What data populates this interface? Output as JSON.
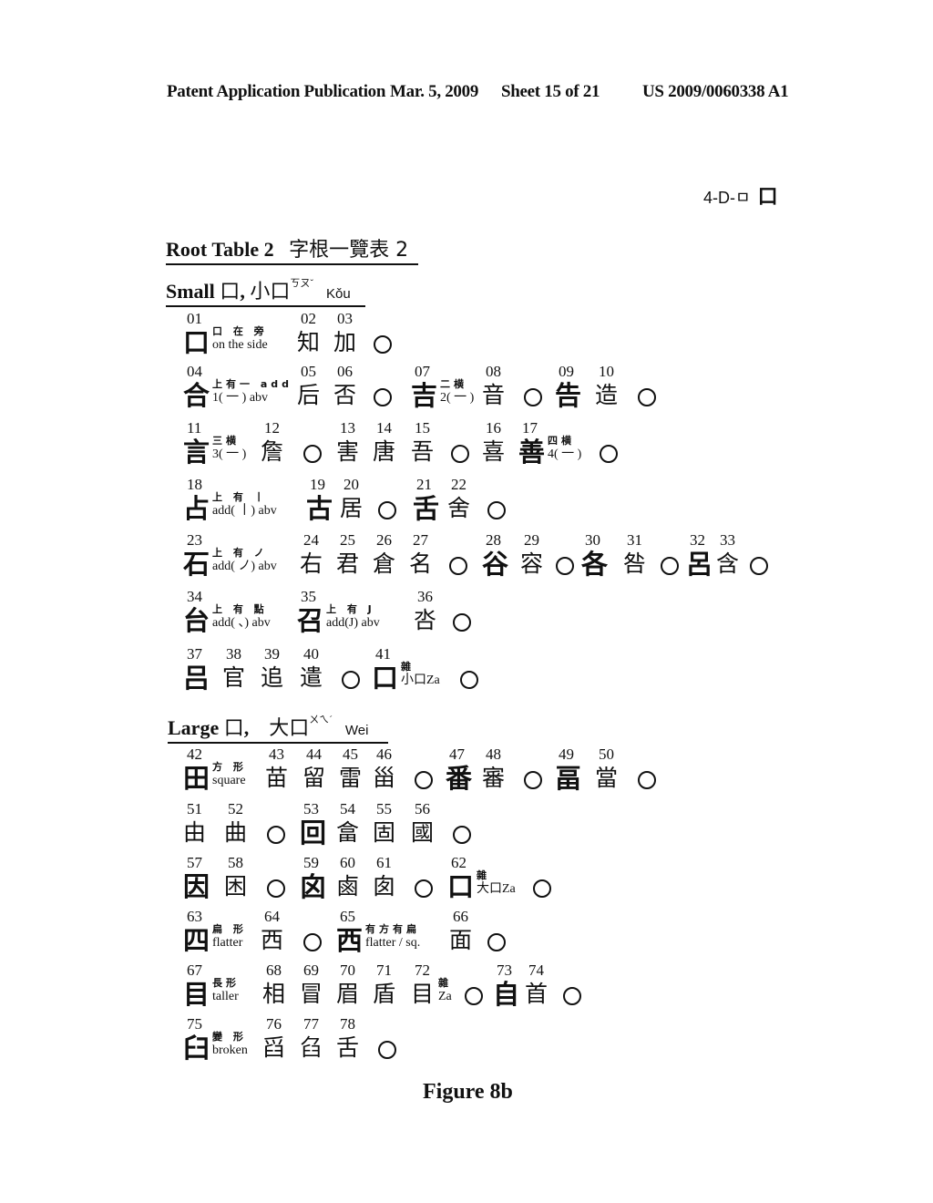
{
  "header": {
    "left": "Patent Application Publication",
    "date": "Mar. 5, 2009",
    "sheet": "Sheet 15 of 21",
    "pubno": "US 2009/0060338 A1"
  },
  "code_label": "4-D-ㅁ",
  "code_box": "口",
  "table_title": {
    "en": "Root Table 2",
    "zh": "字根一覽表 2"
  },
  "small_section": {
    "en": "Small ",
    "glyph": "口",
    "sep": ", ",
    "zh": "小口",
    "zhuyin": "ㄎㄡˇ",
    "pinyin": "Kǒu"
  },
  "large_section": {
    "en": "Large ",
    "glyph": "口",
    "sep": ", ",
    "zh": "大口",
    "zhuyin": "ㄨㄟˊ",
    "pinyin": "Wei"
  },
  "entries": [
    {
      "n": "01",
      "c": "口",
      "b": true,
      "ann_top": "口 在 旁",
      "ann_bot": "on the side"
    },
    {
      "n": "02",
      "c": "知"
    },
    {
      "n": "03",
      "c": "加"
    },
    {
      "n": "04",
      "c": "合",
      "b": true,
      "ann_top": "上有一 add",
      "ann_bot": "1( 一 ) abv"
    },
    {
      "n": "05",
      "c": "后"
    },
    {
      "n": "06",
      "c": "否"
    },
    {
      "n": "07",
      "c": "吉",
      "b": true,
      "ann_top": "二横",
      "ann_bot": "2( 一 )"
    },
    {
      "n": "08",
      "c": "音"
    },
    {
      "n": "09",
      "c": "告",
      "b": true
    },
    {
      "n": "10",
      "c": "造"
    },
    {
      "n": "11",
      "c": "言",
      "b": true,
      "ann_top": "三横",
      "ann_bot": "3( 一 )"
    },
    {
      "n": "12",
      "c": "詹"
    },
    {
      "n": "13",
      "c": "害"
    },
    {
      "n": "14",
      "c": "唐"
    },
    {
      "n": "15",
      "c": "吾"
    },
    {
      "n": "16",
      "c": "喜"
    },
    {
      "n": "17",
      "c": "善",
      "b": true,
      "ann_top": "四横",
      "ann_bot": "4( 一 )"
    },
    {
      "n": "18",
      "c": "占",
      "b": true,
      "ann_top": "上 有 丨",
      "ann_bot": "add( 丨) abv"
    },
    {
      "n": "19",
      "c": "古",
      "b": true
    },
    {
      "n": "20",
      "c": "居"
    },
    {
      "n": "21",
      "c": "舌",
      "b": true
    },
    {
      "n": "22",
      "c": "舍"
    },
    {
      "n": "23",
      "c": "石",
      "b": true,
      "ann_top": "上 有 ノ",
      "ann_bot": "add( ノ) abv"
    },
    {
      "n": "24",
      "c": "右"
    },
    {
      "n": "25",
      "c": "君"
    },
    {
      "n": "26",
      "c": "倉"
    },
    {
      "n": "27",
      "c": "名"
    },
    {
      "n": "28",
      "c": "谷",
      "b": true
    },
    {
      "n": "29",
      "c": "容"
    },
    {
      "n": "30",
      "c": "各",
      "b": true
    },
    {
      "n": "31",
      "c": "咎"
    },
    {
      "n": "32",
      "c": "呂",
      "b": true
    },
    {
      "n": "33",
      "c": "含"
    },
    {
      "n": "34",
      "c": "台",
      "b": true,
      "ann_top": "上 有 點",
      "ann_bot": "add( 、) abv"
    },
    {
      "n": "35",
      "c": "召",
      "b": true,
      "ann_top": "上 有 J",
      "ann_bot": "add(J) abv"
    },
    {
      "n": "36",
      "c": "呇"
    },
    {
      "n": "37",
      "c": "吕",
      "b": true
    },
    {
      "n": "38",
      "c": "官"
    },
    {
      "n": "39",
      "c": "追"
    },
    {
      "n": "40",
      "c": "遣"
    },
    {
      "n": "41",
      "c": "口",
      "b": true,
      "ann_top": "雜",
      "ann_bot": "小口Za"
    },
    {
      "n": "42",
      "c": "田",
      "b": true,
      "ann_top": "方 形",
      "ann_bot": "square"
    },
    {
      "n": "43",
      "c": "苗"
    },
    {
      "n": "44",
      "c": "留"
    },
    {
      "n": "45",
      "c": "雷"
    },
    {
      "n": "46",
      "c": "甾"
    },
    {
      "n": "47",
      "c": "番",
      "b": true
    },
    {
      "n": "48",
      "c": "審"
    },
    {
      "n": "49",
      "c": "畐",
      "b": true
    },
    {
      "n": "50",
      "c": "當"
    },
    {
      "n": "51",
      "c": "由"
    },
    {
      "n": "52",
      "c": "曲"
    },
    {
      "n": "53",
      "c": "回",
      "b": true
    },
    {
      "n": "54",
      "c": "畣"
    },
    {
      "n": "55",
      "c": "固"
    },
    {
      "n": "56",
      "c": "國"
    },
    {
      "n": "57",
      "c": "因",
      "b": true
    },
    {
      "n": "58",
      "c": "困"
    },
    {
      "n": "59",
      "c": "囟",
      "b": true
    },
    {
      "n": "60",
      "c": "鹵"
    },
    {
      "n": "61",
      "c": "囱"
    },
    {
      "n": "62",
      "c": "口",
      "b": true,
      "ann_top": "雜",
      "ann_bot": "大口Za"
    },
    {
      "n": "63",
      "c": "四",
      "b": true,
      "ann_top": "扁 形",
      "ann_bot": "flatter"
    },
    {
      "n": "64",
      "c": "西"
    },
    {
      "n": "65",
      "c": "西",
      "b": true,
      "ann_top": "有方有扁",
      "ann_bot": "flatter / sq."
    },
    {
      "n": "66",
      "c": "面"
    },
    {
      "n": "67",
      "c": "目",
      "b": true,
      "ann_top": "長形",
      "ann_bot": "taller"
    },
    {
      "n": "68",
      "c": "相"
    },
    {
      "n": "69",
      "c": "冒"
    },
    {
      "n": "70",
      "c": "眉"
    },
    {
      "n": "71",
      "c": "盾"
    },
    {
      "n": "72",
      "c": "目",
      "ann_top": "雜",
      "ann_bot": "Za"
    },
    {
      "n": "73",
      "c": "自",
      "b": true
    },
    {
      "n": "74",
      "c": "首"
    },
    {
      "n": "75",
      "c": "臼",
      "b": true,
      "ann_top": "變 形",
      "ann_bot": "broken"
    },
    {
      "n": "76",
      "c": "舀"
    },
    {
      "n": "77",
      "c": "臽"
    },
    {
      "n": "78",
      "c": "舌"
    }
  ],
  "figure_label": "Figure 8b"
}
